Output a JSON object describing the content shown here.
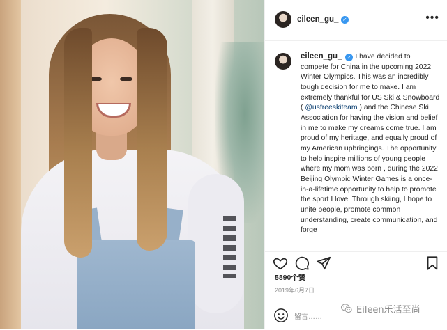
{
  "header": {
    "username": "eileen_gu_",
    "more_icon": "more-horizontal-icon"
  },
  "caption": {
    "username": "eileen_gu_",
    "text_before_mention": "I have decided to compete for China in the upcoming 2022 Winter Olympics. This was an incredibly tough decision for me to make. I am extremely thankful for US Ski & Snowboard ( ",
    "mention": "@usfreeskiteam",
    "text_after_mention": " ) and the Chinese Ski Association for having the vision and belief in me to make my dreams come true. I am proud of my heritage, and equally proud of my American upbringings. The opportunity to help inspire millions of young people where my mom was born , during the 2022 Beijing Olympic Winter Games is a once-in-a-lifetime opportunity to help to promote the sport I love. Through skiing, I hope to unite people, promote common understanding, create communication, and forge"
  },
  "actions": {
    "icons": [
      "heart-icon",
      "comment-icon",
      "share-icon",
      "bookmark-icon"
    ]
  },
  "likes": "5890个赞",
  "date": "2019年6月7日",
  "comment": {
    "placeholder": "留言……",
    "emoji_icon": "smiley-icon"
  },
  "watermark": {
    "text": "Eileen乐活至尚"
  },
  "colors": {
    "verified_badge": "#3897f0",
    "mention_link": "#00376b",
    "meta_text": "#8e8e8e"
  }
}
